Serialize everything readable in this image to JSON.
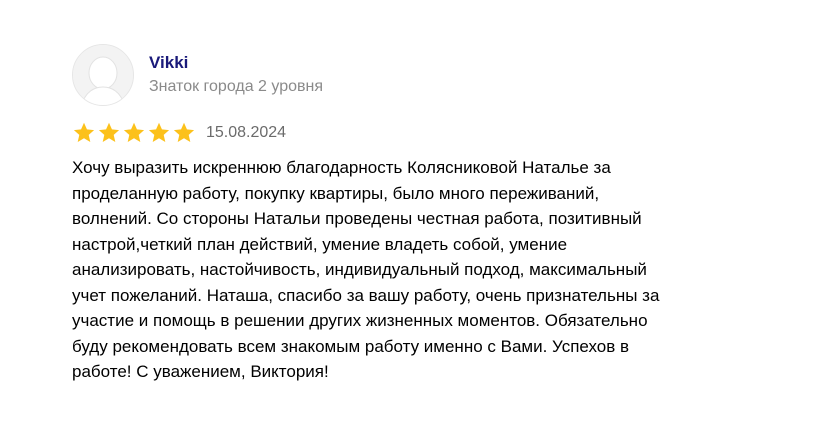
{
  "review": {
    "author": {
      "name": "Vikki",
      "level": "Знаток города 2 уровня",
      "avatar_icon": "default-user-avatar-icon"
    },
    "rating": {
      "value": 5,
      "max": 5,
      "star_color": "#fcc11b"
    },
    "date": "15.08.2024",
    "lines": [
      "Хочу выразить искреннюю благодарность Колясниковой Наталье за",
      "проделанную работу, покупку квартиры, было много переживаний,",
      "волнений. Со стороны Натальи проведены честная работа, позитивный",
      "настрой,четкий план действий, умение владеть собой, умение",
      "анализировать, настойчивость, индивидуальный подход, максимальный",
      "учет пожеланий. Наташа, спасибо за вашу работу, очень признательны за",
      "участие и помощь в решении других жизненных моментов. Обязательно",
      "буду рекомендовать всем знакомым работу именно с Вами. Успехов в",
      "работе! С уважением, Виктория!"
    ]
  },
  "colors": {
    "author_name": "#1a1a7a",
    "muted_text": "#8a8a8a",
    "body_text": "#000000"
  }
}
